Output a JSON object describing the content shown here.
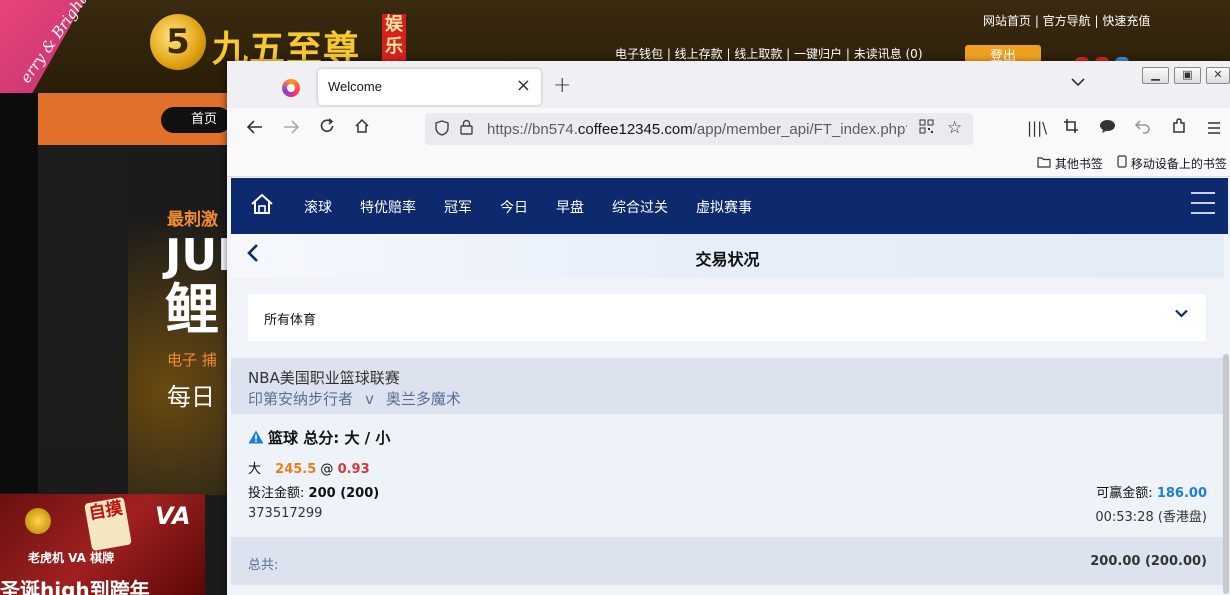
{
  "background_site": {
    "xmas_text": "erry & Bright",
    "logo_mark": "5",
    "logo_name": "九五至尊",
    "logo_badge": "娱乐",
    "top_links": "网站首页 | 官方导航 | 快速充值",
    "sub_links": "电子钱包 | 线上存款 | 线上取款 | 一键归户 | 未读讯息 (0)",
    "login_button": "登出",
    "home_tab": "首页",
    "promo_header": "最刺激",
    "promo_big1": "JUM",
    "promo_big2": "鲤",
    "promo_sub": "电子 捕",
    "promo_daily": "每日",
    "banner_tile": "自摸",
    "banner_va": "VA",
    "banner_row": "老虎机 VA 棋牌",
    "banner_bottom": "圣诞high到跨年"
  },
  "browser": {
    "tab_title": "Welcome",
    "url_prefix": "https://bn574.",
    "url_domain": "coffee12345.com",
    "url_path": "/app/member_api/FT_index.php?",
    "bookmarks": {
      "other": "其他书签",
      "mobile": "移动设备上的书签"
    }
  },
  "site_nav": {
    "items": [
      "滚球",
      "特优赔率",
      "冠军",
      "今日",
      "早盘",
      "综合过关",
      "虚拟赛事"
    ]
  },
  "page": {
    "title": "交易状况",
    "sport_filter": "所有体育",
    "league": "NBA美国职业篮球联赛",
    "home_team": "印第安纳步行者",
    "vs": "v",
    "away_team": "奥兰多魔术",
    "bet_type": "篮球 总分: 大 / 小",
    "selection": "大",
    "line": "245.5",
    "at": "@",
    "odds": "0.93",
    "stake_label": "投注金额:",
    "stake_value": "200 (200)",
    "win_label": "可赢金额:",
    "win_value": "186.00",
    "bet_id": "373517299",
    "bet_time": "00:53:28 (香港盘)",
    "total_label": "总共:",
    "total_value": "200.00 (200.00)"
  },
  "colors": {
    "nav_bg": "#0e2a6e",
    "line_color": "#e8801a",
    "odds_color": "#d83838",
    "win_color": "#1a7fd6"
  }
}
